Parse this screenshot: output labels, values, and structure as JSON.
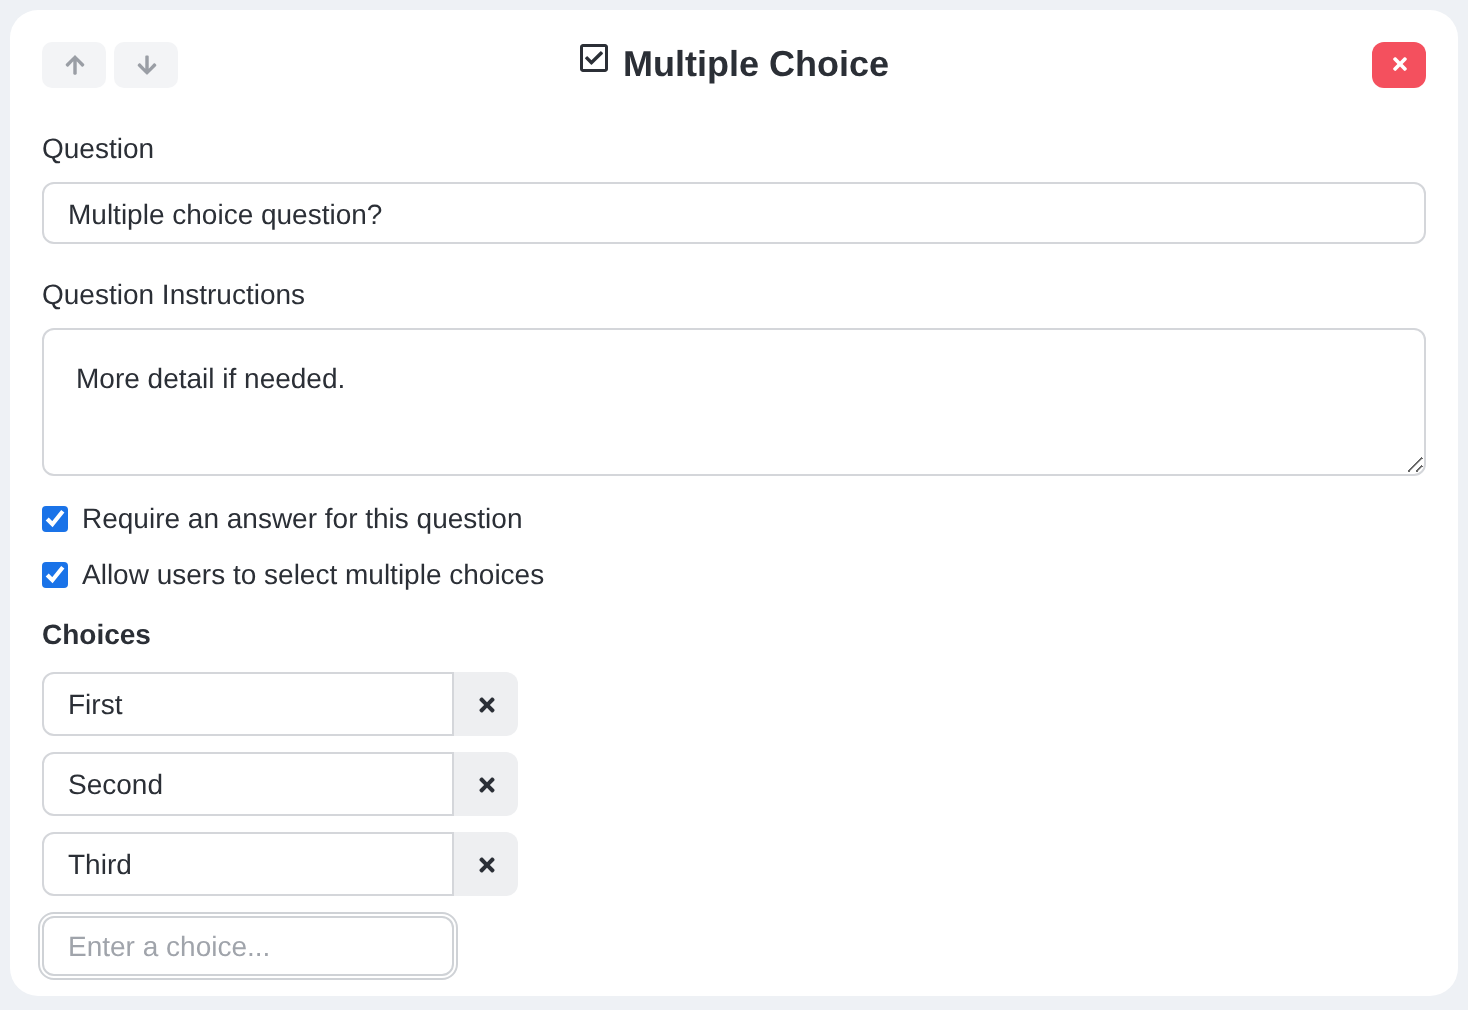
{
  "header": {
    "title": "Multiple Choice"
  },
  "question": {
    "label": "Question",
    "value": "Multiple choice question?"
  },
  "instructions": {
    "label": "Question Instructions",
    "value": "More detail if needed."
  },
  "options": [
    {
      "label": "Require an answer for this question",
      "checked": true
    },
    {
      "label": "Allow users to select multiple choices",
      "checked": true
    }
  ],
  "choices_heading": "Choices",
  "choices": [
    {
      "value": "First"
    },
    {
      "value": "Second"
    },
    {
      "value": "Third"
    }
  ],
  "new_choice": {
    "placeholder": "Enter a choice..."
  }
}
